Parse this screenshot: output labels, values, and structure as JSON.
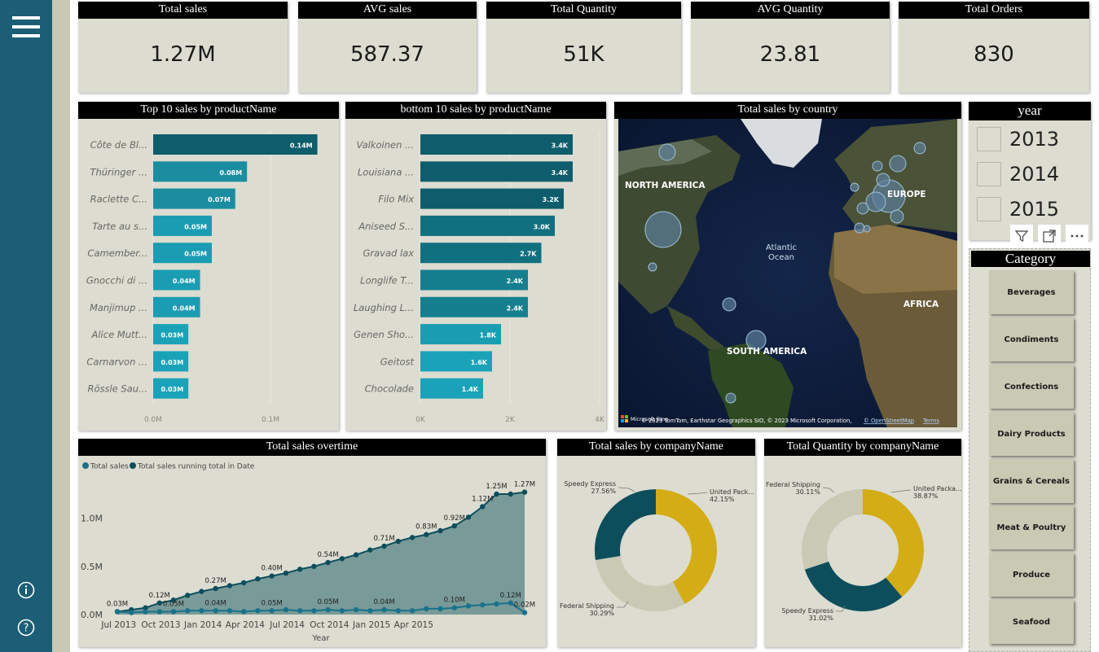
{
  "kpis": [
    {
      "label": "Total sales",
      "value": "1.27M"
    },
    {
      "label": "AVG sales",
      "value": "587.37"
    },
    {
      "label": "Total Quantity",
      "value": "51K"
    },
    {
      "label": "AVG Quantity",
      "value": "23.81"
    },
    {
      "label": "Total Orders",
      "value": "830"
    }
  ],
  "top10": {
    "title": "Top 10 sales by productName",
    "type": "bar",
    "categories": [
      "Côte de Bl...",
      "Thüringer ...",
      "Raclette C...",
      "Tarte au s...",
      "Camember...",
      "Gnocchi di ...",
      "Manjimup ...",
      "Alice Mutt...",
      "Carnarvon ...",
      "Rössle Sau..."
    ],
    "values": [
      0.14,
      0.08,
      0.07,
      0.05,
      0.05,
      0.04,
      0.04,
      0.03,
      0.03,
      0.03
    ],
    "labels": [
      "0.14M",
      "0.08M",
      "0.07M",
      "0.05M",
      "0.05M",
      "0.04M",
      "0.04M",
      "0.03M",
      "0.03M",
      "0.03M"
    ],
    "xticks": [
      "0.0M",
      "0.1M"
    ],
    "xlim": [
      0,
      0.2
    ],
    "colors": [
      "#0e5d6c",
      "#1a8ea0",
      "#1a8ea0",
      "#1a9db2",
      "#1a9db2",
      "#1a9db2",
      "#1a9db2",
      "#1aa3b8",
      "#1aa3b8",
      "#1aa3b8"
    ]
  },
  "bottom10": {
    "title": "bottom 10 sales by productName",
    "type": "bar",
    "categories": [
      "Valkoinen ...",
      "Louisiana ...",
      "Filo Mix",
      "Aniseed S...",
      "Gravad lax",
      "Longlife T...",
      "Laughing L...",
      "Genen Sho...",
      "Geitost",
      "Chocolade"
    ],
    "values": [
      3.4,
      3.4,
      3.2,
      3.0,
      2.7,
      2.4,
      2.4,
      1.8,
      1.6,
      1.4
    ],
    "labels": [
      "3.4K",
      "3.4K",
      "3.2K",
      "3.0K",
      "2.7K",
      "2.4K",
      "2.4K",
      "1.8K",
      "1.6K",
      "1.4K"
    ],
    "xticks": [
      "0K",
      "2K",
      "4K"
    ],
    "xlim": [
      0,
      4
    ],
    "colors": [
      "#0e5d6c",
      "#0e5d6c",
      "#0e5d6c",
      "#11707f",
      "#11707f",
      "#157f8f",
      "#157f8f",
      "#1a9db2",
      "#1aa3b8",
      "#1aa3b8"
    ]
  },
  "map": {
    "title": "Total sales by country",
    "labels": [
      "NORTH AMERICA",
      "Atlantic\nOcean",
      "EUROPE",
      "AFRICA",
      "SOUTH AMERICA"
    ],
    "atlantic_line1": "Atlantic",
    "atlantic_line2": "Ocean",
    "attribution": "© 2023 TomTom, Earthstar Geographics SIO, © 2023 Microsoft Corporation, ",
    "osm": "© OpenStreetMap",
    "terms": "Terms",
    "ms": "Microsoft Bing"
  },
  "year": {
    "title": "year",
    "items": [
      "2013",
      "2014",
      "2015"
    ]
  },
  "category": {
    "title": "Category",
    "items": [
      "Beverages",
      "Condiments",
      "Confections",
      "Dairy Products",
      "Grains & Cereals",
      "Meat & Poultry",
      "Produce",
      "Seafood"
    ]
  },
  "overtime": {
    "title": "Total sales overtime",
    "legend": [
      "Total sales",
      "Total sales running total in Date"
    ],
    "xlabel": "Year",
    "xticks": [
      "Jul 2013",
      "Oct 2013",
      "Jan 2014",
      "Apr 2014",
      "Jul 2014",
      "Oct 2014",
      "Jan 2015",
      "Apr 2015"
    ],
    "yticks": [
      "0.0M",
      "0.5M",
      "1.0M"
    ],
    "chart_data": {
      "type": "area",
      "ylim": [
        0,
        1.4
      ],
      "series": [
        {
          "name": "Total sales running total in Date",
          "values": [
            0.03,
            0.05,
            0.07,
            0.12,
            0.15,
            0.2,
            0.24,
            0.27,
            0.3,
            0.33,
            0.37,
            0.4,
            0.43,
            0.47,
            0.5,
            0.54,
            0.58,
            0.62,
            0.67,
            0.71,
            0.76,
            0.8,
            0.83,
            0.87,
            0.92,
            1.01,
            1.12,
            1.25,
            1.25,
            1.27
          ]
        },
        {
          "name": "Total sales",
          "values": [
            0.03,
            0.02,
            0.03,
            0.03,
            0.03,
            0.04,
            0.04,
            0.04,
            0.04,
            0.03,
            0.04,
            0.04,
            0.05,
            0.04,
            0.04,
            0.05,
            0.04,
            0.05,
            0.04,
            0.05,
            0.04,
            0.04,
            0.06,
            0.06,
            0.07,
            0.09,
            0.1,
            0.11,
            0.12,
            0.02
          ]
        }
      ]
    },
    "data_labels": [
      {
        "i": 0,
        "s": 0,
        "t": "0.03M"
      },
      {
        "i": 3,
        "s": 0,
        "t": "0.12M"
      },
      {
        "i": 4,
        "s": 1,
        "t": "0.05M"
      },
      {
        "i": 7,
        "s": 0,
        "t": "0.27M"
      },
      {
        "i": 7,
        "s": 1,
        "t": "0.04M"
      },
      {
        "i": 11,
        "s": 0,
        "t": "0.40M"
      },
      {
        "i": 11,
        "s": 1,
        "t": "0.05M"
      },
      {
        "i": 15,
        "s": 0,
        "t": "0.54M"
      },
      {
        "i": 15,
        "s": 1,
        "t": "0.05M"
      },
      {
        "i": 19,
        "s": 0,
        "t": "0.71M"
      },
      {
        "i": 19,
        "s": 1,
        "t": "0.04M"
      },
      {
        "i": 22,
        "s": 0,
        "t": "0.83M"
      },
      {
        "i": 24,
        "s": 0,
        "t": "0.92M"
      },
      {
        "i": 24,
        "s": 1,
        "t": "0.10M"
      },
      {
        "i": 26,
        "s": 0,
        "t": "1.12M"
      },
      {
        "i": 27,
        "s": 0,
        "t": "1.25M"
      },
      {
        "i": 29,
        "s": 0,
        "t": "1.27M"
      },
      {
        "i": 28,
        "s": 1,
        "t": "0.12M"
      },
      {
        "i": 29,
        "s": 1,
        "t": "0.02M"
      }
    ]
  },
  "donut_sales": {
    "title": "Total sales by companyName",
    "chart_data": {
      "type": "pie",
      "categories": [
        "United Pack...",
        "Federal Shipping",
        "Speedy Express"
      ],
      "values": [
        42.15,
        30.29,
        27.56
      ],
      "labels": [
        "42.15%",
        "30.29%",
        "27.56%"
      ],
      "colors": [
        "#d4ac16",
        "#c9c9b4",
        "#0d4e5c"
      ]
    }
  },
  "donut_qty": {
    "title": "Total Quantity by companyName",
    "chart_data": {
      "type": "pie",
      "categories": [
        "United Packa...",
        "Speedy Express",
        "Federal Shipping"
      ],
      "values": [
        38.87,
        31.02,
        30.11
      ],
      "labels": [
        "38.87%",
        "31.02%",
        "30.11%"
      ],
      "colors": [
        "#d4ac16",
        "#0d4e5c",
        "#c9c9b4"
      ]
    }
  }
}
